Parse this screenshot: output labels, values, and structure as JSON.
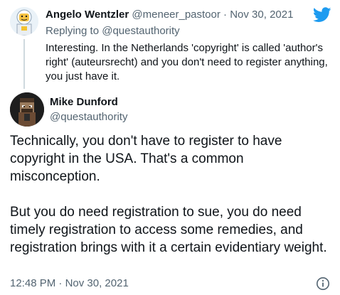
{
  "parent_tweet": {
    "author_name": "Angelo Wentzler",
    "author_handle": "@meneer_pastoor",
    "separator": "·",
    "date": "Nov 30, 2021",
    "replying_label": "Replying to",
    "replying_handle": "@questauthority",
    "text": "Interesting. In the Netherlands 'copyright' is called 'author's right' (auteursrecht) and you don't need to register anything, you just have it."
  },
  "main_tweet": {
    "author_name": "Mike Dunford",
    "author_handle": "@questauthority",
    "paragraph_1": "Technically, you don't have to register to have copyright in the USA. That's a common misconception.",
    "paragraph_2": "But you do need registration to sue, you do need timely registration to access some remedies, and registration brings with it a certain evidentiary weight.",
    "time": "12:48 PM",
    "separator": "·",
    "date": "Nov 30, 2021"
  },
  "icons": {
    "brand": "twitter-bird-icon",
    "info": "info-icon"
  },
  "colors": {
    "brand_blue": "#1d9bf0",
    "text_primary": "#0f1419",
    "text_secondary": "#536471",
    "thread_line": "#cfd9de"
  }
}
